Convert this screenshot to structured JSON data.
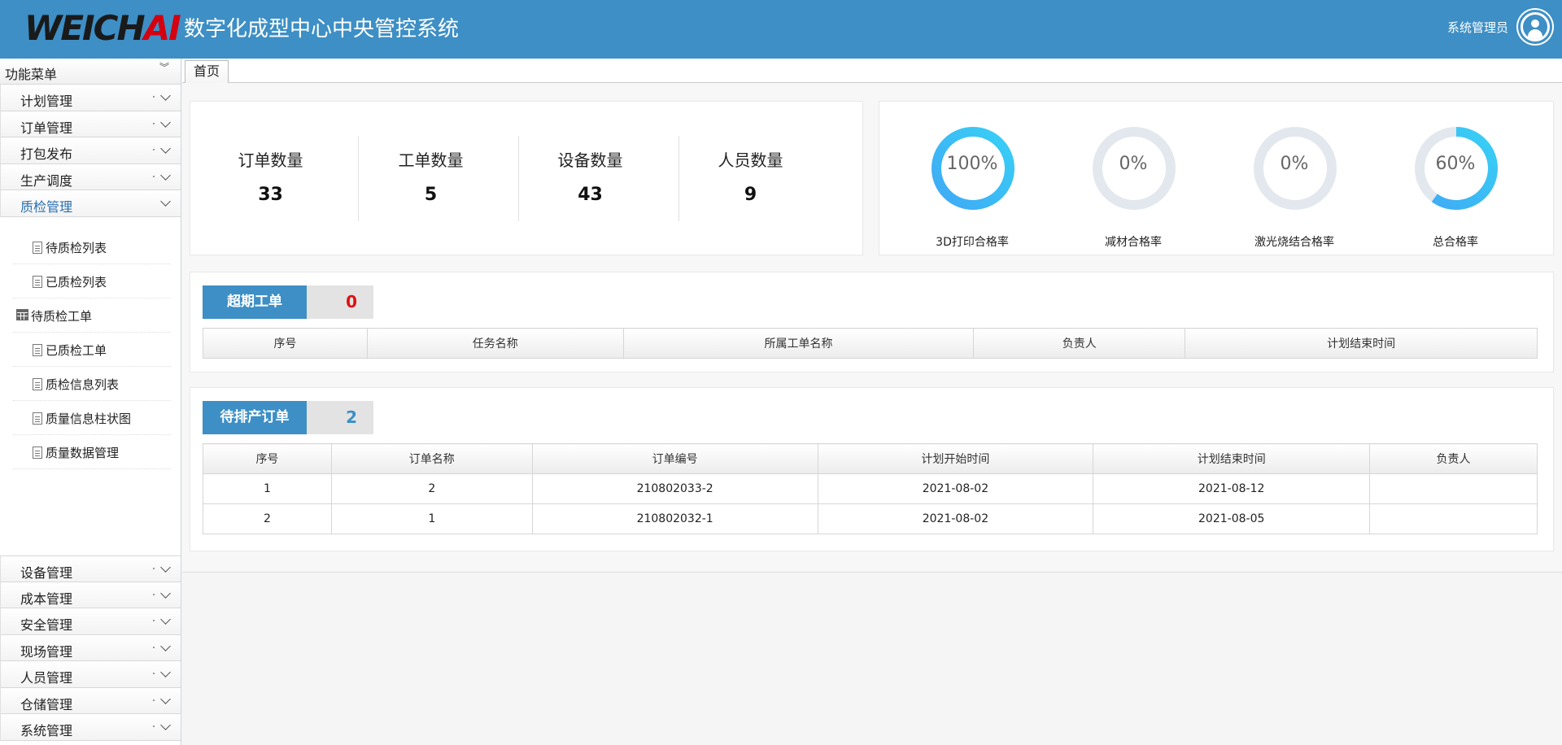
{
  "header": {
    "logo_main": "WEICH",
    "logo_accent": "AI",
    "title": "数字化成型中心中央管控系统",
    "user_name": "系统管理员"
  },
  "sidebar": {
    "heading": "功能菜单",
    "top_items": [
      {
        "label": "计划管理"
      },
      {
        "label": "订单管理"
      },
      {
        "label": "打包发布"
      },
      {
        "label": "生产调度"
      },
      {
        "label": "质检管理",
        "active": true
      }
    ],
    "sub_items": [
      {
        "label": "待质检列表"
      },
      {
        "label": "已质检列表"
      },
      {
        "label": "待质检工单"
      },
      {
        "label": "已质检工单"
      },
      {
        "label": "质检信息列表"
      },
      {
        "label": "质量信息柱状图"
      },
      {
        "label": "质量数据管理"
      }
    ],
    "bottom_items": [
      {
        "label": "设备管理"
      },
      {
        "label": "成本管理"
      },
      {
        "label": "安全管理"
      },
      {
        "label": "现场管理"
      },
      {
        "label": "人员管理"
      },
      {
        "label": "仓储管理"
      },
      {
        "label": "系统管理"
      }
    ]
  },
  "tabs": [
    {
      "label": "首页"
    }
  ],
  "stats": [
    {
      "label": "订单数量",
      "value": "33"
    },
    {
      "label": "工单数量",
      "value": "5"
    },
    {
      "label": "设备数量",
      "value": "43"
    },
    {
      "label": "人员数量",
      "value": "9"
    }
  ],
  "gauges": [
    {
      "label": "3D打印合格率",
      "text": "100%",
      "percent": 100
    },
    {
      "label": "减材合格率",
      "text": "0%",
      "percent": 0
    },
    {
      "label": "激光烧结合格率",
      "text": "0%",
      "percent": 0
    },
    {
      "label": "总合格率",
      "text": "60%",
      "percent": 60
    }
  ],
  "colors": {
    "primary": "#3d8fc5",
    "gauge_track": "#e3e8ee",
    "gauge_fill_start": "#3fa9f5",
    "gauge_fill_end": "#38d0f5",
    "overdue_count": "#e01010"
  },
  "overdue": {
    "title": "超期工单",
    "count": "0",
    "columns": [
      "序号",
      "任务名称",
      "所属工单名称",
      "负责人",
      "计划结束时间"
    ],
    "rows": []
  },
  "pending": {
    "title": "待排产订单",
    "count": "2",
    "columns": [
      "序号",
      "订单名称",
      "订单编号",
      "计划开始时间",
      "计划结束时间",
      "负责人"
    ],
    "rows": [
      [
        "1",
        "2",
        "210802033-2",
        "2021-08-02",
        "2021-08-12",
        ""
      ],
      [
        "2",
        "1",
        "210802032-1",
        "2021-08-02",
        "2021-08-05",
        ""
      ]
    ]
  }
}
